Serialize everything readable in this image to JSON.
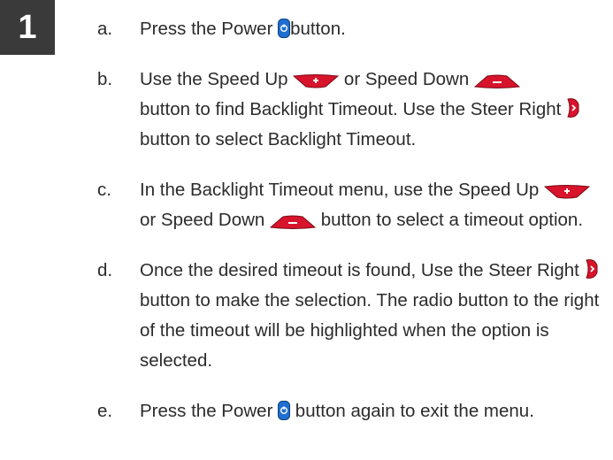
{
  "step_number": "1",
  "icons": {
    "power": "power-button-icon",
    "speed_up": "speed-up-plus-icon",
    "speed_down": "speed-down-minus-icon",
    "steer_right": "steer-right-arrow-icon"
  },
  "colors": {
    "power_button": "#1f6fd1",
    "red_buttons": "#d7142c",
    "badge": "#3a3a3a"
  },
  "steps": [
    {
      "letter": "a.",
      "t1": "Press the Power ",
      "t2": "button."
    },
    {
      "letter": "b.",
      "t1": "Use the Speed Up ",
      "t2": " or Speed Down ",
      "t3": "button to find Backlight Timeout. Use the Steer Right ",
      "t4": " button to select Backlight Timeout."
    },
    {
      "letter": "c.",
      "t1": "In the Backlight Timeout menu, use the Speed Up ",
      "t2": " or Speed Down ",
      "t3": " button to select a timeout option."
    },
    {
      "letter": "d.",
      "t1": "Once the desired timeout is found, Use the Steer Right ",
      "t2": " button to make the selection. The radio button to the right of the timeout will be highlighted when the option is selected."
    },
    {
      "letter": "e.",
      "t1": "Press the Power ",
      "t2": " button again to exit the menu."
    }
  ]
}
